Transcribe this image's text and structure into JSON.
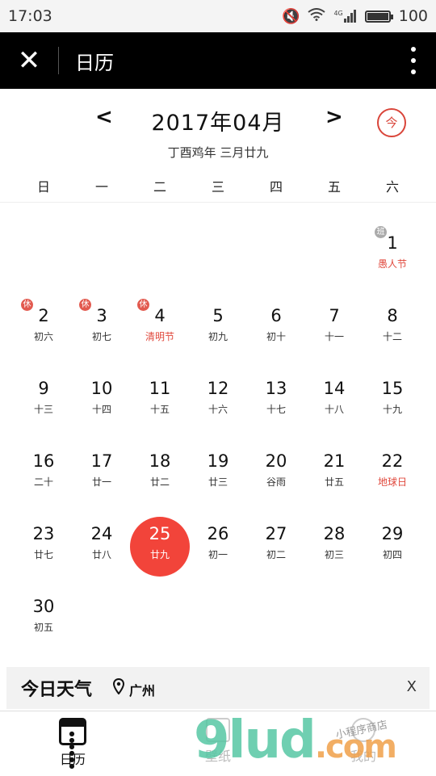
{
  "status_bar": {
    "time": "17:03",
    "network": "4G",
    "battery": "100"
  },
  "app_bar": {
    "close_label": "✕",
    "title": "日历"
  },
  "header": {
    "prev_label": "<",
    "next_label": ">",
    "month_title": "2017年04月",
    "today_label": "今",
    "lunar_title": "丁酉鸡年 三月廿九",
    "weekdays": [
      "日",
      "一",
      "二",
      "三",
      "四",
      "五",
      "六"
    ]
  },
  "calendar": {
    "selected_day": 25,
    "weeks": [
      [
        {
          "day": "",
          "lunar": ""
        },
        {
          "day": "",
          "lunar": ""
        },
        {
          "day": "",
          "lunar": ""
        },
        {
          "day": "",
          "lunar": ""
        },
        {
          "day": "",
          "lunar": ""
        },
        {
          "day": "",
          "lunar": ""
        },
        {
          "day": "1",
          "lunar": "愚人节",
          "lunar_red": true,
          "badge": "班",
          "badge_type": "work"
        }
      ],
      [
        {
          "day": "2",
          "lunar": "初六",
          "badge": "休"
        },
        {
          "day": "3",
          "lunar": "初七",
          "badge": "休"
        },
        {
          "day": "4",
          "lunar": "清明节",
          "lunar_red": true,
          "badge": "休"
        },
        {
          "day": "5",
          "lunar": "初九"
        },
        {
          "day": "6",
          "lunar": "初十"
        },
        {
          "day": "7",
          "lunar": "十一"
        },
        {
          "day": "8",
          "lunar": "十二"
        }
      ],
      [
        {
          "day": "9",
          "lunar": "十三"
        },
        {
          "day": "10",
          "lunar": "十四"
        },
        {
          "day": "11",
          "lunar": "十五"
        },
        {
          "day": "12",
          "lunar": "十六"
        },
        {
          "day": "13",
          "lunar": "十七"
        },
        {
          "day": "14",
          "lunar": "十八"
        },
        {
          "day": "15",
          "lunar": "十九"
        }
      ],
      [
        {
          "day": "16",
          "lunar": "二十"
        },
        {
          "day": "17",
          "lunar": "廿一"
        },
        {
          "day": "18",
          "lunar": "廿二"
        },
        {
          "day": "19",
          "lunar": "廿三"
        },
        {
          "day": "20",
          "lunar": "谷雨"
        },
        {
          "day": "21",
          "lunar": "廿五"
        },
        {
          "day": "22",
          "lunar": "地球日",
          "lunar_red": true
        }
      ],
      [
        {
          "day": "23",
          "lunar": "廿七"
        },
        {
          "day": "24",
          "lunar": "廿八"
        },
        {
          "day": "25",
          "lunar": "廿九",
          "selected": true
        },
        {
          "day": "26",
          "lunar": "初一"
        },
        {
          "day": "27",
          "lunar": "初二"
        },
        {
          "day": "28",
          "lunar": "初三"
        },
        {
          "day": "29",
          "lunar": "初四"
        }
      ],
      [
        {
          "day": "30",
          "lunar": "初五"
        },
        {
          "day": "",
          "lunar": ""
        },
        {
          "day": "",
          "lunar": ""
        },
        {
          "day": "",
          "lunar": ""
        },
        {
          "day": "",
          "lunar": ""
        },
        {
          "day": "",
          "lunar": ""
        },
        {
          "day": "",
          "lunar": ""
        }
      ]
    ]
  },
  "weather": {
    "title": "今日天气",
    "city": "广州",
    "close_label": "X"
  },
  "bottom_nav": {
    "tabs": [
      {
        "label": "日历"
      },
      {
        "label": "壁纸"
      },
      {
        "label": "我的"
      }
    ]
  },
  "watermark": {
    "main": "9lud",
    "suffix": ".com",
    "small": "小程序商店"
  },
  "colors": {
    "accent": "#f2443a",
    "holiday_text": "#e0483c",
    "app_bar_bg": "#000000"
  }
}
